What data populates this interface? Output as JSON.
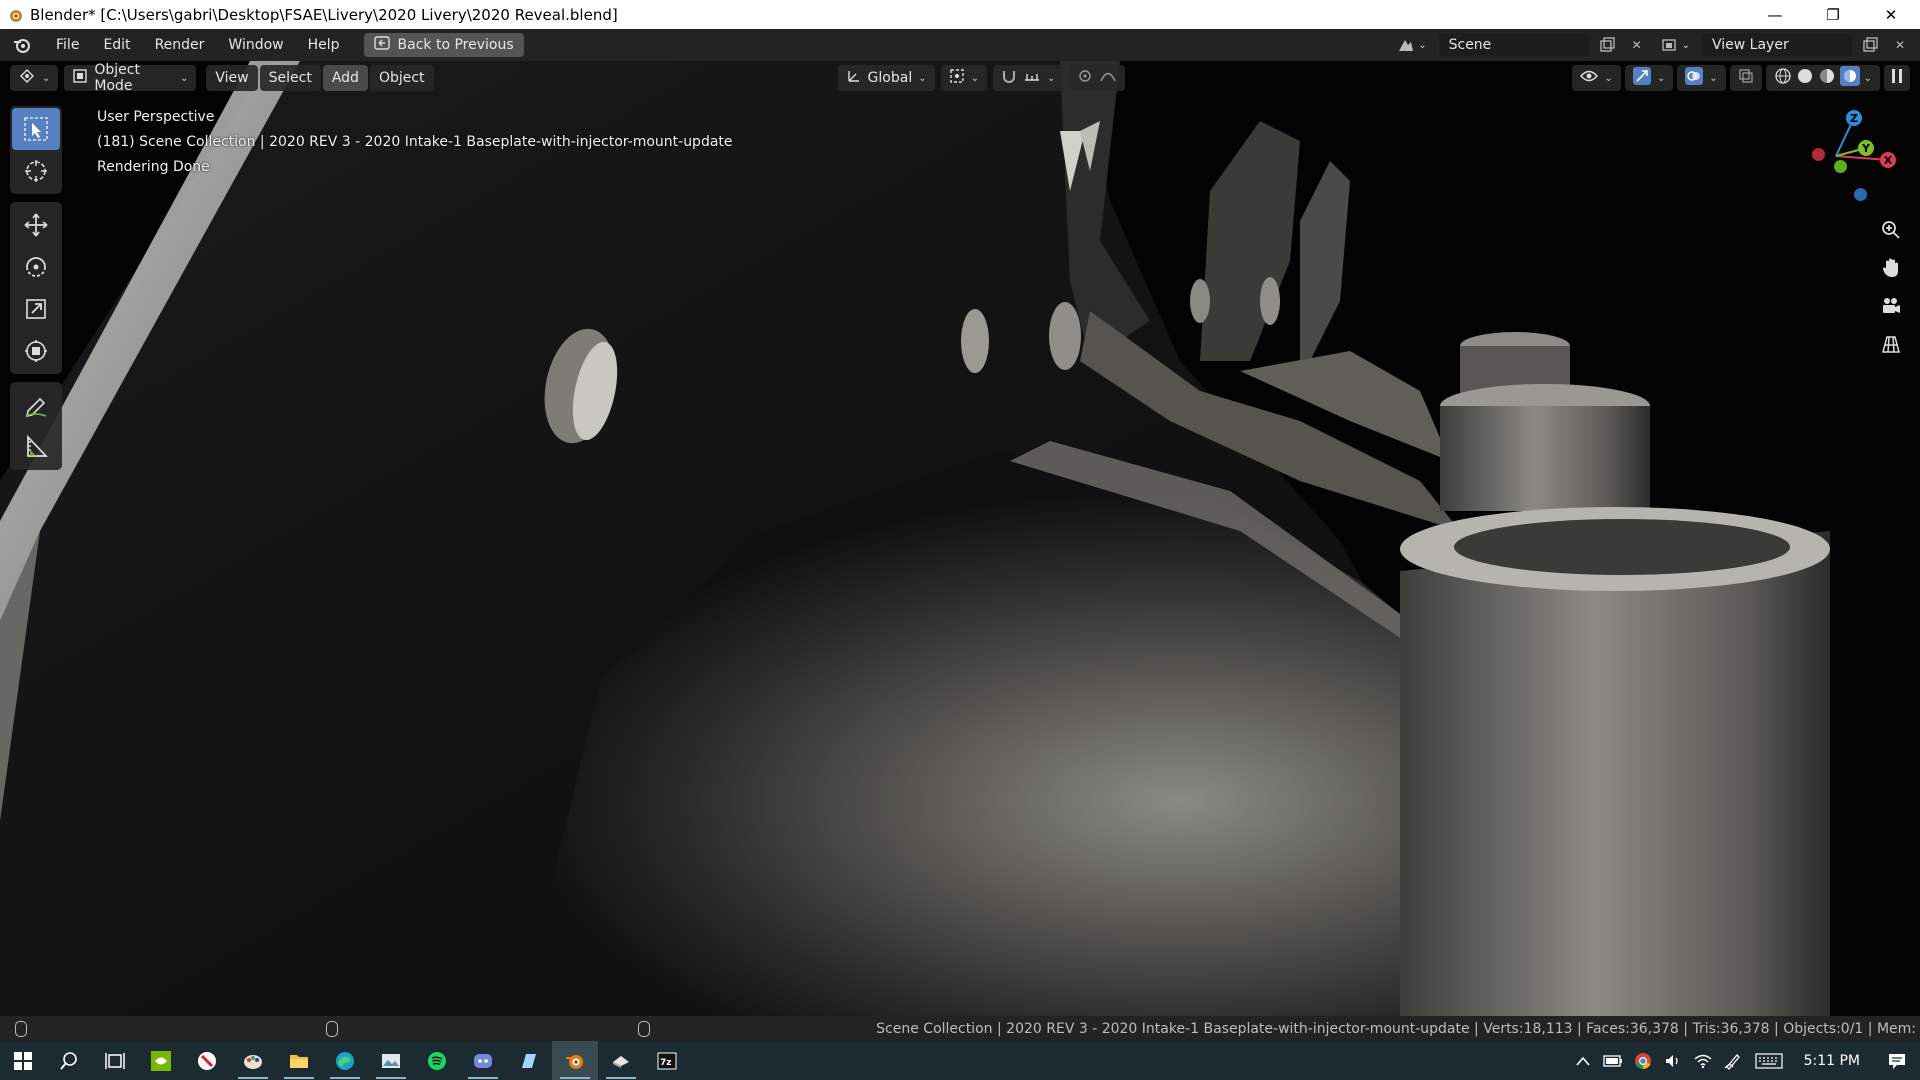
{
  "window": {
    "title": "Blender* [C:\\Users\\gabri\\Desktop\\FSAE\\Livery\\2020 Livery\\2020 Reveal.blend]",
    "minimize": "—",
    "restore": "❐",
    "close": "✕"
  },
  "menubar": {
    "items": [
      "File",
      "Edit",
      "Render",
      "Window",
      "Help"
    ],
    "back_button": "Back to Previous",
    "scene": "Scene",
    "view_layer": "View Layer"
  },
  "viewport_header": {
    "mode": "Object Mode",
    "menus": [
      "View",
      "Select",
      "Add",
      "Object"
    ],
    "active_menu": "Add",
    "transform_orientation": "Global"
  },
  "overlay": {
    "perspective": "User Perspective",
    "collection": "(181) Scene Collection | 2020 REV 3 - 2020 Intake-1 Baseplate-with-injector-mount-update",
    "status": "Rendering Done"
  },
  "gizmo": {
    "x": "X",
    "y": "Y",
    "z": "Z"
  },
  "statusbar": {
    "stats": "Scene Collection | 2020 REV 3 - 2020 Intake-1 Baseplate-with-injector-mount-update | Verts:18,113 | Faces:36,378 | Tris:36,378 | Objects:0/1 | Mem:"
  },
  "taskbar": {
    "time": "5:11 PM",
    "apps": [
      "windows-start",
      "search",
      "task-view",
      "nvidia",
      "app-red",
      "app-paint",
      "file-explorer",
      "edge",
      "photos",
      "spotify",
      "discord",
      "app-blue",
      "blender",
      "app-cloud",
      "7zip"
    ]
  },
  "colors": {
    "accent_active_tool": "#5680c2",
    "axis_x": "#e23a4e",
    "axis_y": "#7bbf28",
    "axis_z": "#2f8ce0",
    "menubar_bg": "#232323",
    "taskbar_bg": "#1c2a31"
  }
}
